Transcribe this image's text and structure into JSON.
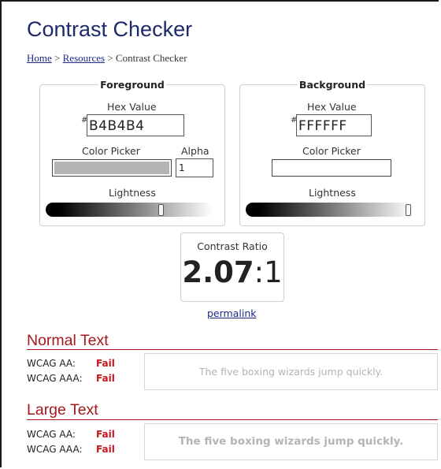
{
  "page": {
    "title": "Contrast Checker",
    "breadcrumb": {
      "home": "Home",
      "sep1": " > ",
      "resources": "Resources",
      "sep2": " > ",
      "current": "Contrast Checker"
    }
  },
  "foreground": {
    "legend": "Foreground",
    "hex_label": "Hex Value",
    "hash": "#",
    "hex_value": "B4B4B4",
    "picker_label": "Color Picker",
    "alpha_label": "Alpha",
    "alpha_value": "1",
    "lightness_label": "Lightness",
    "lightness_level": 0.7,
    "swatch_color": "#b4b4b4"
  },
  "background": {
    "legend": "Background",
    "hex_label": "Hex Value",
    "hash": "#",
    "hex_value": "FFFFFF",
    "picker_label": "Color Picker",
    "lightness_label": "Lightness",
    "lightness_level": 1.0,
    "swatch_color": "#ffffff"
  },
  "ratio": {
    "label": "Contrast Ratio",
    "value": "2.07",
    "suffix": ":1"
  },
  "permalink": "permalink",
  "normal_text": {
    "heading": "Normal Text",
    "aa_label": "WCAG AA:",
    "aa_result": "Fail",
    "aaa_label": "WCAG AAA:",
    "aaa_result": "Fail",
    "sample": "The five boxing wizards jump quickly."
  },
  "large_text": {
    "heading": "Large Text",
    "aa_label": "WCAG AA:",
    "aa_result": "Fail",
    "aaa_label": "WCAG AAA:",
    "aaa_result": "Fail",
    "sample": "The five boxing wizards jump quickly."
  },
  "colors": {
    "heading_blue": "#1d2a6b",
    "fail_red": "#c8161d",
    "section_red": "#a4181c"
  }
}
